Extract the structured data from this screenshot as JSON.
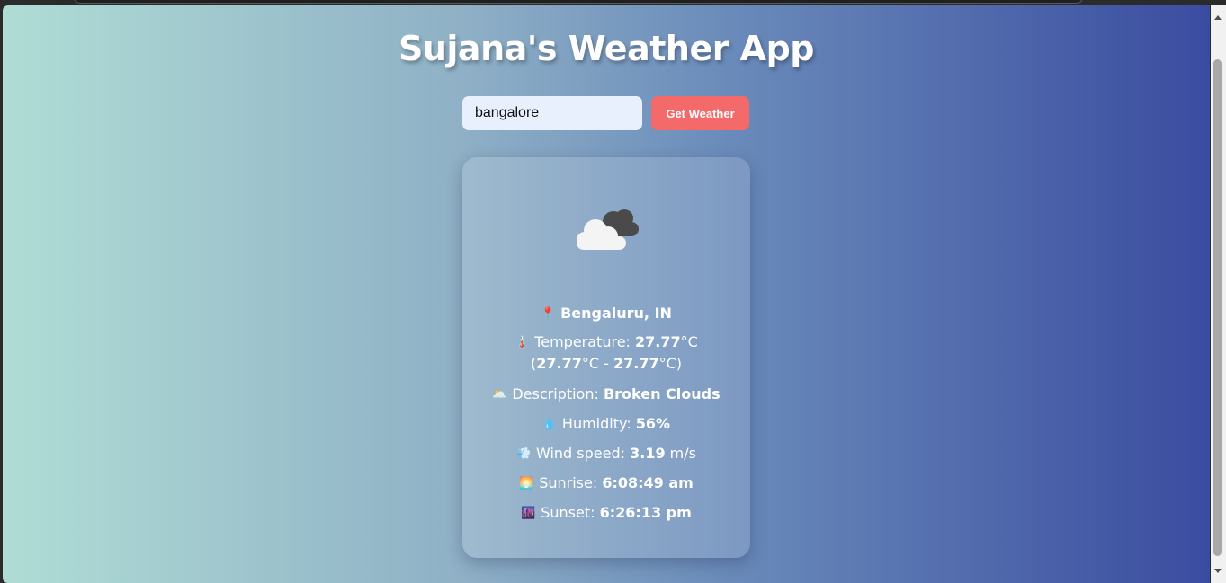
{
  "app": {
    "title": "Sujana's Weather App"
  },
  "search": {
    "value": "bangalore",
    "button_label": "Get Weather"
  },
  "weather": {
    "location": "Bengaluru, IN",
    "temperature_label": "Temperature: ",
    "temperature": "27.77",
    "temp_unit": "°C",
    "temp_min": "27.77",
    "temp_max": "27.77",
    "range_open": "(",
    "range_sep": "°C - ",
    "range_close": "°C)",
    "description_label": "Description: ",
    "description": "Broken Clouds",
    "humidity_label": "Humidity: ",
    "humidity": "56%",
    "wind_label": "Wind speed: ",
    "wind": "3.19",
    "wind_unit": " m/s",
    "sunrise_label": "Sunrise: ",
    "sunrise": "6:08:49 am",
    "sunset_label": "Sunset: ",
    "sunset": "6:26:13 pm"
  },
  "icons": {
    "weather": "cloud-icon",
    "location": "pin-icon",
    "temperature": "thermometer-icon",
    "description": "sun-behind-cloud-icon",
    "humidity": "droplet-icon",
    "wind": "wind-icon",
    "sunrise": "sunrise-icon",
    "sunset": "sunset-icon"
  },
  "colors": {
    "button": "#f46a6a",
    "input_bg": "#e8f0fe",
    "gradient_start": "#afddd5",
    "gradient_end": "#3a4ca0"
  }
}
